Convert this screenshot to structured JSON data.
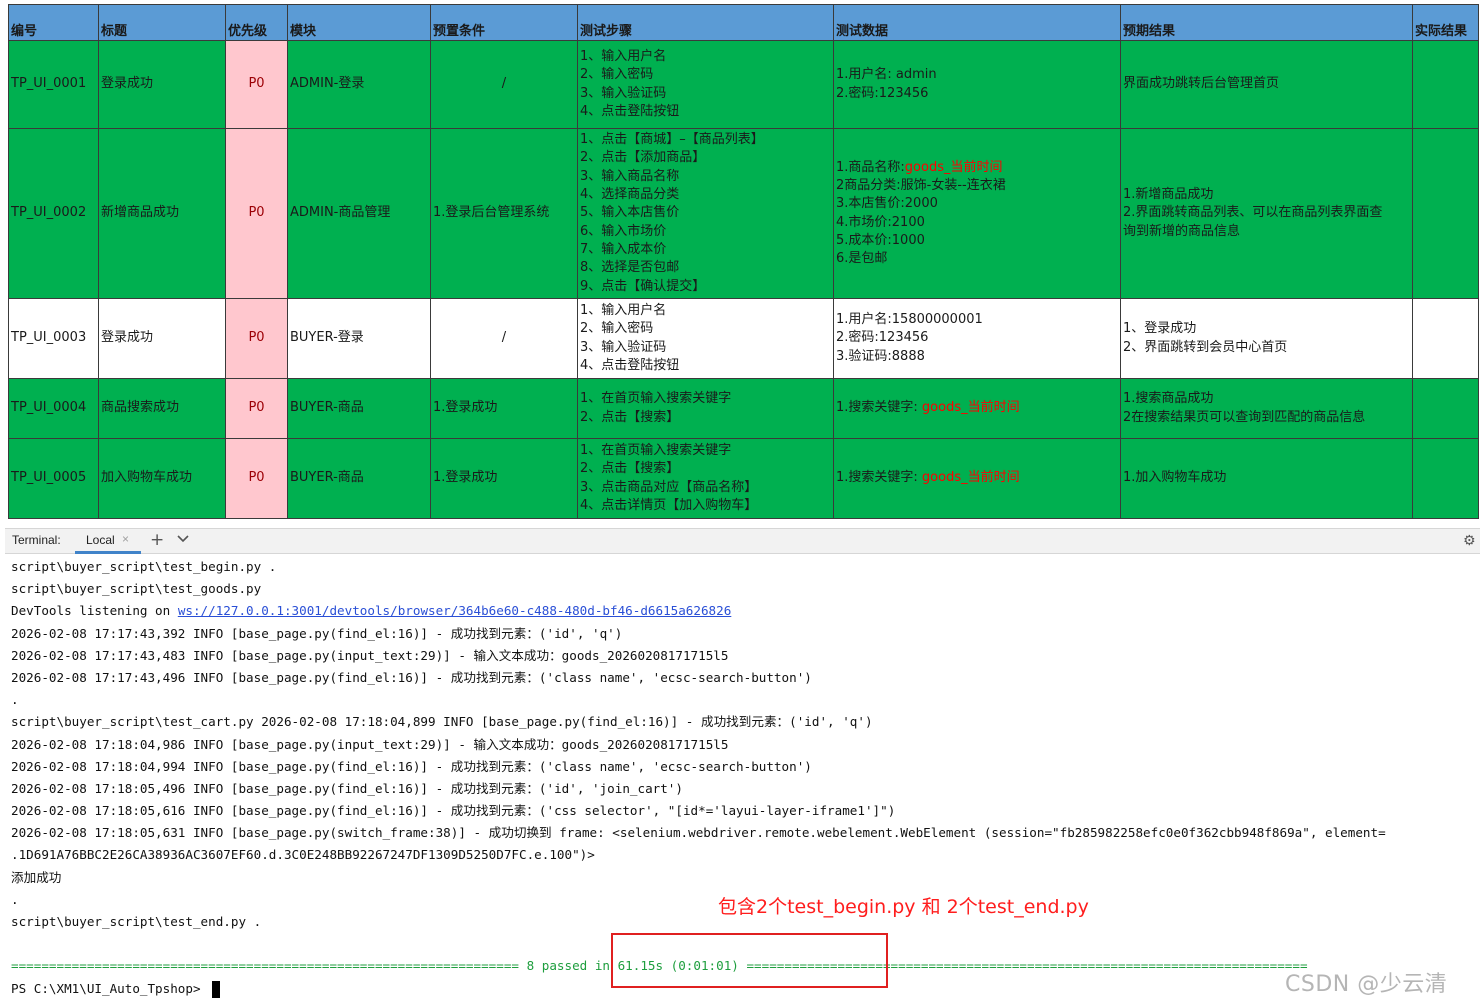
{
  "spreadsheet": {
    "headers": [
      "编号",
      "标题",
      "优先级",
      "模块",
      "预置条件",
      "测试步骤",
      "测试数据",
      "预期结果",
      "实际结果"
    ],
    "rows": [
      {
        "id": "TP_UI_0001",
        "title": "登录成功",
        "priority": "P0",
        "module": "ADMIN-登录",
        "precondition": "/",
        "steps": [
          "1、输入用户名",
          "2、输入密码",
          "3、输入验证码",
          "4、点击登陆按钮"
        ],
        "data": [
          {
            "text": "1.用户名: admin"
          },
          {
            "text": " 2.密码:123456"
          }
        ],
        "expected": [
          "界面成功跳转后台管理首页"
        ],
        "actual": ""
      },
      {
        "id": "TP_UI_0002",
        "title": "新增商品成功",
        "priority": "P0",
        "module": "ADMIN-商品管理",
        "precondition": "1.登录后台管理系统",
        "steps": [
          "1、点击【商城】–【商品列表】",
          "2、点击【添加商品】",
          "3、输入商品名称",
          "4、选择商品分类",
          "5、输入本店售价",
          "6、输入市场价",
          "7、输入成本价",
          "8、选择是否包邮",
          "9、点击【确认提交】"
        ],
        "data": [
          {
            "text": "1.商品名称:",
            "red": "goods_当前时间"
          },
          {
            "text": "2商品分类:服饰-女装--连衣裙"
          },
          {
            "text": "3.本店售价:2000"
          },
          {
            "text": "4.市场价:2100"
          },
          {
            "text": "5.成本价:1000"
          },
          {
            "text": "6.是包邮"
          }
        ],
        "expected": [
          "1.新增商品成功",
          "2.界面跳转商品列表、可以在商品列表界面查",
          "询到新增的商品信息"
        ],
        "actual": ""
      },
      {
        "id": "TP_UI_0003",
        "title": "登录成功",
        "priority": "P0",
        "module": "BUYER-登录",
        "precondition": "/",
        "steps": [
          "1、输入用户名",
          "2、输入密码",
          "3、输入验证码",
          "4、点击登陆按钮"
        ],
        "data": [
          {
            "text": "1.用户名:15800000001"
          },
          {
            "text": " 2.密码:123456"
          },
          {
            "text": "3.验证码:8888"
          }
        ],
        "expected": [
          "1、登录成功",
          "2、界面跳转到会员中心首页"
        ],
        "actual": ""
      },
      {
        "id": "TP_UI_0004",
        "title": "商品搜索成功",
        "priority": "P0",
        "module": "BUYER-商品",
        "precondition": "1.登录成功",
        "steps": [
          "1、在首页输入搜索关键字",
          "2、点击【搜索】"
        ],
        "data": [
          {
            "text": "1.搜索关键字: ",
            "red": "goods_当前时间"
          }
        ],
        "expected": [
          "1.搜索商品成功",
          "2在搜索结果页可以查询到匹配的商品信息"
        ],
        "actual": ""
      },
      {
        "id": "TP_UI_0005",
        "title": "加入购物车成功",
        "priority": "P0",
        "module": "BUYER-商品",
        "precondition": "1.登录成功",
        "steps": [
          "1、在首页输入搜索关键字",
          "2、点击【搜索】",
          "3、点击商品对应【商品名称】",
          "4、点击详情页【加入购物车】"
        ],
        "data": [
          {
            "text": "1.搜索关键字: ",
            "red": "goods_当前时间"
          }
        ],
        "expected": [
          "1.加入购物车成功"
        ],
        "actual": ""
      }
    ]
  },
  "terminal": {
    "label": "Terminal:",
    "tab_label": "Local",
    "tab_close": "×",
    "add_label": "+",
    "icons": [
      "chevron-down-icon",
      "gear-icon"
    ],
    "lines": [
      "script\\buyer_script\\test_begin.py .",
      "script\\buyer_script\\test_goods.py",
      "2026-02-08 17:17:43,392 INFO [base_page.py(find_el:16)] - 成功找到元素：('id', 'q')",
      "2026-02-08 17:17:43,483 INFO [base_page.py(input_text:29)] - 输入文本成功：goods_20260208171715l5",
      "2026-02-08 17:17:43,496 INFO [base_page.py(find_el:16)] - 成功找到元素：('class name', 'ecsc-search-button')",
      ".",
      "script\\buyer_script\\test_cart.py 2026-02-08 17:18:04,899 INFO [base_page.py(find_el:16)] - 成功找到元素：('id', 'q')",
      "2026-02-08 17:18:04,986 INFO [base_page.py(input_text:29)] - 输入文本成功：goods_20260208171715l5",
      "2026-02-08 17:18:04,994 INFO [base_page.py(find_el:16)] - 成功找到元素：('class name', 'ecsc-search-button')",
      "2026-02-08 17:18:05,496 INFO [base_page.py(find_el:16)] - 成功找到元素：('id', 'join_cart')",
      "2026-02-08 17:18:05,616 INFO [base_page.py(find_el:16)] - 成功找到元素：('css selector', \"[id*='layui-layer-iframe1']\")",
      "2026-02-08 17:18:05,631 INFO [base_page.py(switch_frame:38)] - 成功切换到 frame: <selenium.webdriver.remote.webelement.WebElement (session=\"fb285982258efc0e0f362cbb948f869a\", element=",
      ".1D691A76BBC2E26CA38936AC3607EF60.d.3C0E248BB92267247DF1309D5250D7FC.e.100\")>",
      "添加成功",
      ".",
      "script\\buyer_script\\test_end.py .",
      ""
    ],
    "devtools_prefix": "DevTools listening on ",
    "devtools_url": "ws://127.0.0.1:3001/devtools/browser/364b6e60-c488-480d-bf46-d6615a626826",
    "sep_left": "===================================================================",
    "summary": " 8 passed in 61.15s (0:01:01) ",
    "sep_right": "==========================================================================",
    "prompt": "PS C:\\XM1\\UI_Auto_Tpshop> "
  },
  "annotation": "包含2个test_begin.py  和  2个test_end.py",
  "watermark": "CSDN @少云清",
  "colors": {
    "header": "#5b9bd5",
    "pass_row": "#00b050",
    "priority": "#ffc7ce",
    "annotation": "#ff1d1d"
  }
}
